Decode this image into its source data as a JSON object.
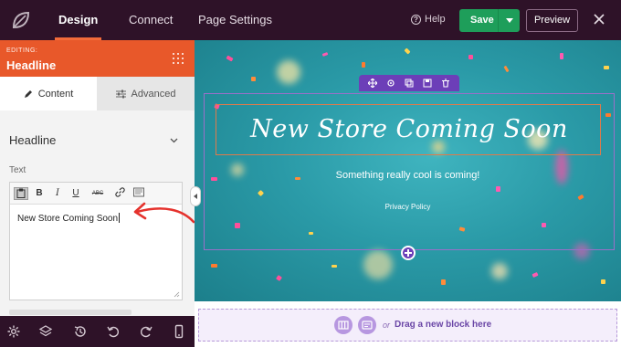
{
  "topbar": {
    "logo_icon": "seedprod-leaf-icon",
    "tabs": [
      {
        "label": "Design",
        "active": true
      },
      {
        "label": "Connect",
        "active": false
      },
      {
        "label": "Page Settings",
        "active": false
      }
    ],
    "help_label": "Help",
    "save_label": "Save",
    "preview_label": "Preview"
  },
  "panel": {
    "editing_caption": "EDITING:",
    "editing_title": "Headline",
    "tabs": [
      {
        "label": "Content",
        "icon": "pencil-icon",
        "active": true
      },
      {
        "label": "Advanced",
        "icon": "sliders-icon",
        "active": false
      }
    ],
    "section_title": "Headline",
    "text_label": "Text",
    "editor_value": "New Store Coming Soon",
    "toolbar_buttons": [
      "paste-icon",
      "B",
      "I",
      "U",
      "ABC",
      "link-icon",
      "source-icon"
    ]
  },
  "bottom_toolbar": [
    "gear-icon",
    "layers-icon",
    "history-icon",
    "undo-icon",
    "redo-icon",
    "mobile-icon"
  ],
  "canvas": {
    "headline": "New Store Coming Soon",
    "subheadline": "Something really cool is coming!",
    "privacy_link": "Privacy Policy",
    "block_tools": [
      "move-icon",
      "settings-icon",
      "copy-icon",
      "save-icon",
      "trash-icon"
    ]
  },
  "dragzone": {
    "or_label": "or",
    "text": "Drag a new block here"
  },
  "colors": {
    "topbar": "#2e1228",
    "accent": "#e8582a",
    "save_green": "#1e9e5a",
    "purple": "#6c3fb8",
    "canvas_teal": "#2a9aa7"
  }
}
